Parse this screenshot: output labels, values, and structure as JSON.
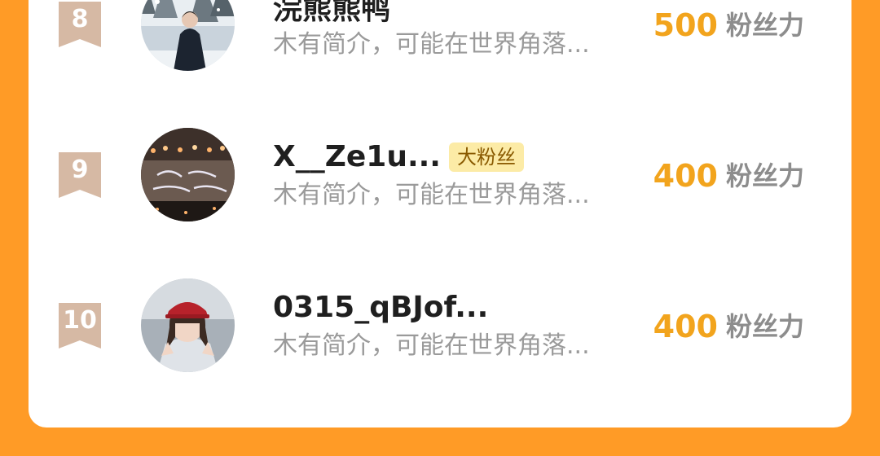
{
  "badge_color": "#D6B9A4",
  "accent_color": "#F2A41D",
  "background_color": "#FF9B26",
  "ranking": [
    {
      "rank": "8",
      "name": "浣熊熊鸭",
      "tag": "",
      "bio": "木有简介，可能在世界角落...",
      "score": "500",
      "unit": "粉丝力",
      "avatar": "snowy-forest-photo"
    },
    {
      "rank": "9",
      "name": "X__Ze1u...",
      "tag": "大粉丝",
      "bio": "木有简介，可能在世界角落...",
      "score": "400",
      "unit": "粉丝力",
      "avatar": "concert-stage-photo"
    },
    {
      "rank": "10",
      "name": "0315_qBJof...",
      "tag": "",
      "bio": "木有简介，可能在世界角落...",
      "score": "400",
      "unit": "粉丝力",
      "avatar": "girl-red-cap-photo"
    }
  ]
}
